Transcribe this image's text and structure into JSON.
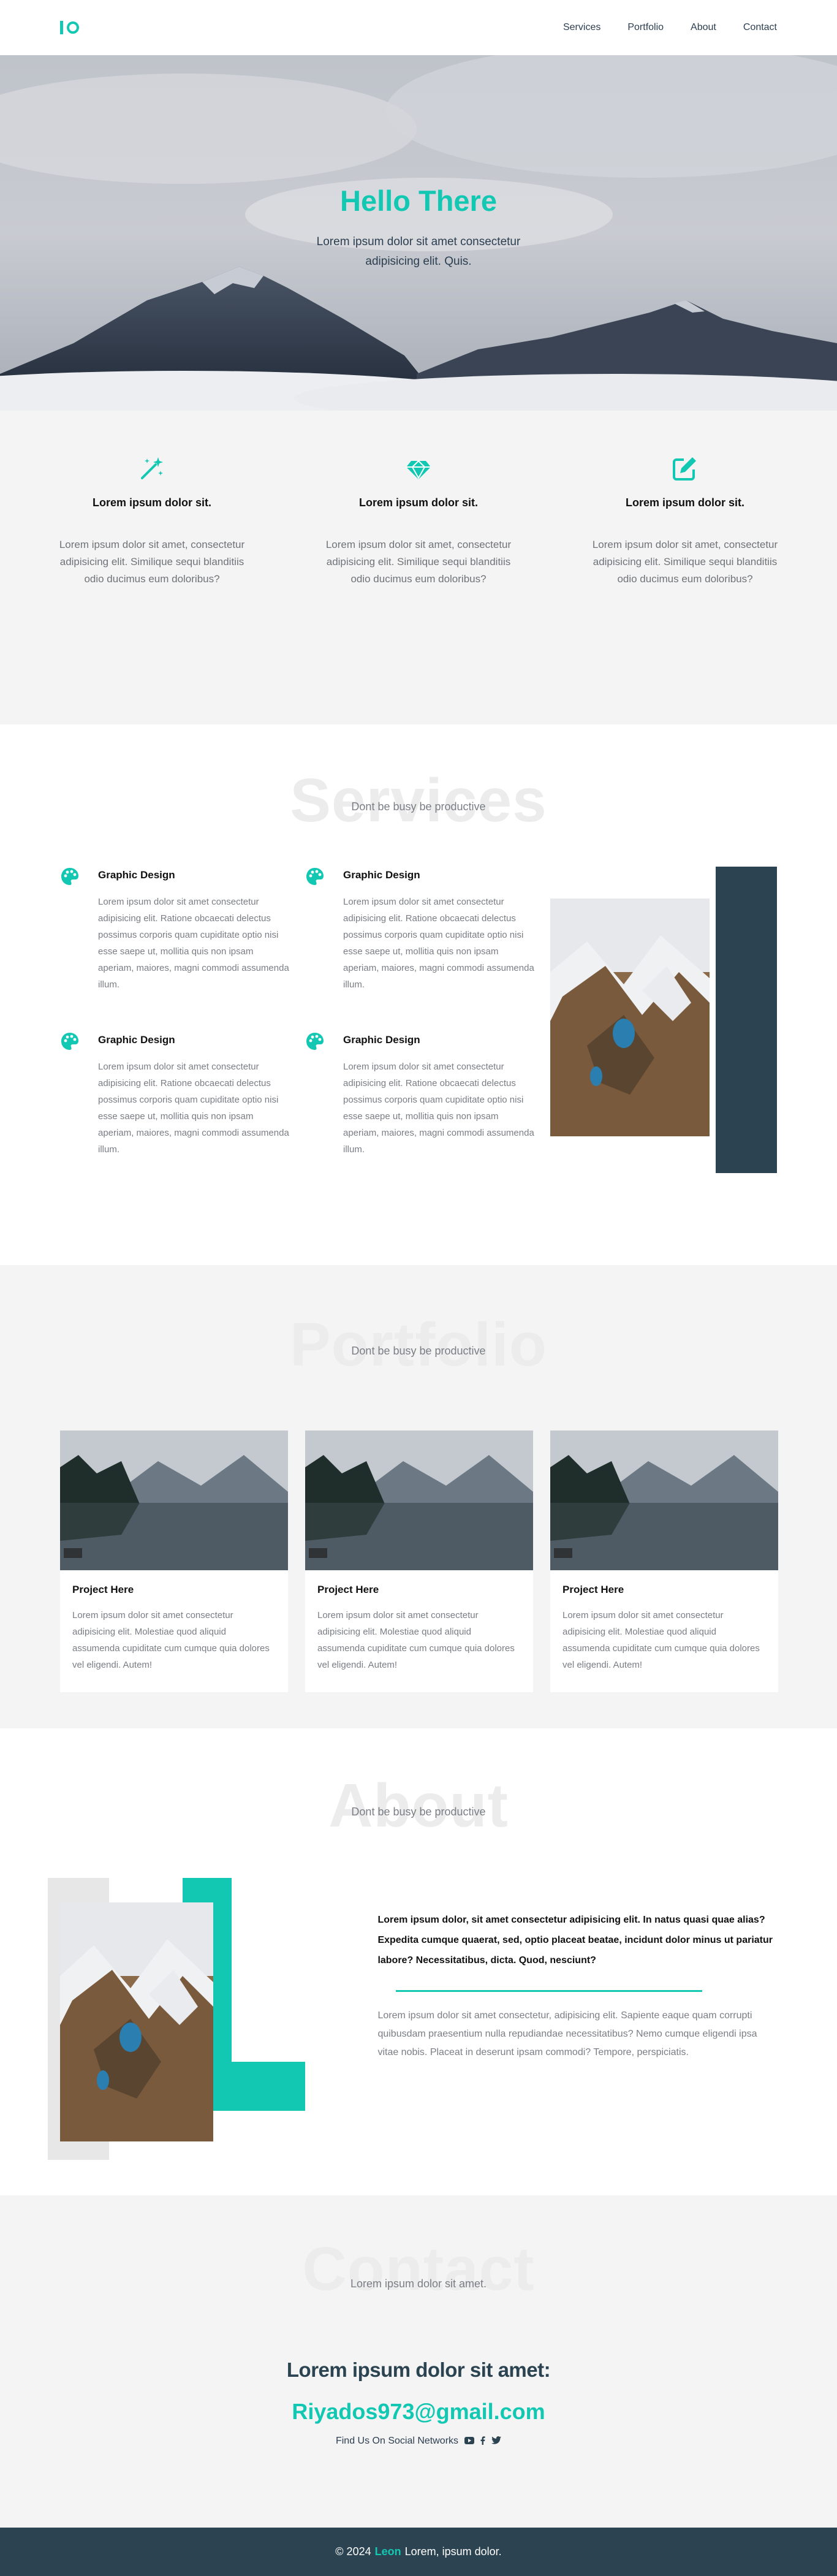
{
  "nav": {
    "items": [
      "Services",
      "Portfolio",
      "About",
      "Contact"
    ]
  },
  "hero": {
    "title": "Hello There",
    "text": "Lorem ipsum dolor sit amet consectetur adipisicing elit. Quis."
  },
  "features": [
    {
      "icon": "magic-wand-icon",
      "title": "Lorem ipsum dolor sit.",
      "text": "Lorem ipsum dolor sit amet, consectetur adipisicing elit. Similique sequi blanditiis odio ducimus eum doloribus?"
    },
    {
      "icon": "gem-icon",
      "title": "Lorem ipsum dolor sit.",
      "text": "Lorem ipsum dolor sit amet, consectetur adipisicing elit. Similique sequi blanditiis odio ducimus eum doloribus?"
    },
    {
      "icon": "edit-icon",
      "title": "Lorem ipsum dolor sit.",
      "text": "Lorem ipsum dolor sit amet, consectetur adipisicing elit. Similique sequi blanditiis odio ducimus eum doloribus?"
    }
  ],
  "services": {
    "title": "Services",
    "subtitle": "Dont be busy be productive",
    "items": [
      {
        "icon": "palette-icon",
        "title": "Graphic Design",
        "text": "Lorem ipsum dolor sit amet consectetur adipisicing elit. Ratione obcaecati delectus possimus corporis quam cupiditate optio nisi esse saepe ut, mollitia quis non ipsam aperiam, maiores, magni commodi assumenda illum."
      },
      {
        "icon": "palette-icon",
        "title": "Graphic Design",
        "text": "Lorem ipsum dolor sit amet consectetur adipisicing elit. Ratione obcaecati delectus possimus corporis quam cupiditate optio nisi esse saepe ut, mollitia quis non ipsam aperiam, maiores, magni commodi assumenda illum."
      },
      {
        "icon": "palette-icon",
        "title": "Graphic Design",
        "text": "Lorem ipsum dolor sit amet consectetur adipisicing elit. Ratione obcaecati delectus possimus corporis quam cupiditate optio nisi esse saepe ut, mollitia quis non ipsam aperiam, maiores, magni commodi assumenda illum."
      },
      {
        "icon": "palette-icon",
        "title": "Graphic Design",
        "text": "Lorem ipsum dolor sit amet consectetur adipisicing elit. Ratione obcaecati delectus possimus corporis quam cupiditate optio nisi esse saepe ut, mollitia quis non ipsam aperiam, maiores, magni commodi assumenda illum."
      }
    ]
  },
  "portfolio": {
    "title": "Portfolio",
    "subtitle": "Dont be busy be productive",
    "cards": [
      {
        "title": "Project Here",
        "text": "Lorem ipsum dolor sit amet consectetur adipisicing elit. Molestiae quod aliquid assumenda cupiditate cum cumque quia dolores vel eligendi. Autem!"
      },
      {
        "title": "Project Here",
        "text": "Lorem ipsum dolor sit amet consectetur adipisicing elit. Molestiae quod aliquid assumenda cupiditate cum cumque quia dolores vel eligendi. Autem!"
      },
      {
        "title": "Project Here",
        "text": "Lorem ipsum dolor sit amet consectetur adipisicing elit. Molestiae quod aliquid assumenda cupiditate cum cumque quia dolores vel eligendi. Autem!"
      }
    ]
  },
  "about": {
    "title": "About",
    "subtitle": "Dont be busy be productive",
    "bold": "Lorem ipsum dolor, sit amet consectetur adipisicing elit. In natus quasi quae alias? Expedita cumque quaerat, sed, optio placeat beatae, incidunt dolor minus ut pariatur labore? Necessitatibus, dicta. Quod, nesciunt?",
    "plain": "Lorem ipsum dolor sit amet consectetur, adipisicing elit. Sapiente eaque quam corrupti quibusdam praesentium nulla repudiandae necessitatibus? Nemo cumque eligendi ipsa vitae nobis. Placeat in deserunt ipsam commodi? Tempore, perspiciatis."
  },
  "contact": {
    "title": "Contact",
    "subtitle": "Lorem ipsum dolor sit amet.",
    "heading": "Lorem ipsum dolor sit amet:",
    "email": "Riyados973@gmail.com",
    "social_label": "Find Us On Social Networks"
  },
  "footer": {
    "year": "© 2024",
    "brand": "Leon",
    "text": "Lorem, ipsum dolor."
  },
  "colors": {
    "accent": "#13c8b2",
    "dark": "#2c4451",
    "light_bg": "#f4f4f4"
  }
}
